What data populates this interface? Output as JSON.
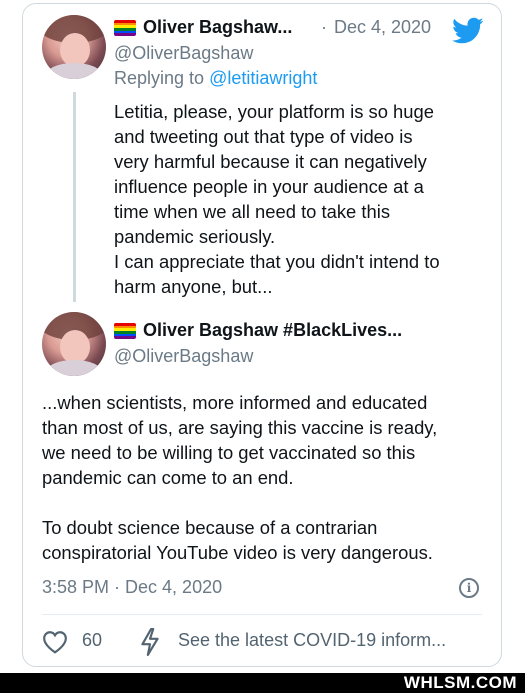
{
  "tweet1": {
    "name": "Oliver Bagshaw...",
    "handle": "@OliverBagshaw",
    "separator": "·",
    "date": "Dec 4, 2020",
    "replying_prefix": "Replying to",
    "replying_to": "@letitiawright",
    "text_lines": [
      "Letitia, please, your platform is so huge",
      "and tweeting out that type of video is",
      "very harmful because it can negatively",
      "influence people in your audience at a",
      "time when we all need to take this",
      "pandemic seriously.",
      "I can appreciate that you didn't intend to",
      "harm anyone, but..."
    ],
    "avatar_icon": "profile-photo",
    "flag_icon": "rainbow-flag",
    "brand_icon": "twitter-bird"
  },
  "tweet2": {
    "name": "Oliver Bagshaw #BlackLives...",
    "handle": "@OliverBagshaw",
    "paragraph1_lines": [
      "...when scientists, more informed and educated",
      "than most of us, are saying this vaccine is ready,",
      "we need to be willing to get vaccinated so this",
      "pandemic can come to an end."
    ],
    "paragraph2_lines": [
      "To doubt science because of a contrarian",
      "conspiratorial YouTube video is very dangerous."
    ],
    "timestamp": "3:58 PM · Dec 4, 2020",
    "info_icon": "info-icon",
    "likes": "60",
    "covid_link": "See the latest COVID-19 inform..."
  },
  "watermark": "WHLSM.COM",
  "colors": {
    "twitter_blue": "#1d9bf0",
    "muted_text": "#6b7a86",
    "border": "#cfd9de"
  }
}
